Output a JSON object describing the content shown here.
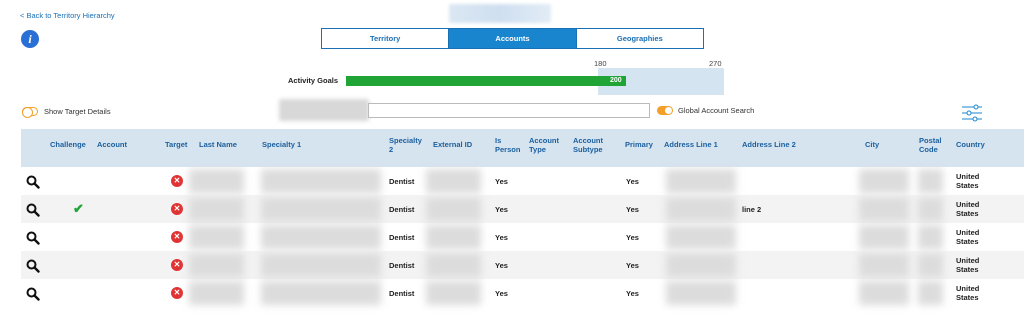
{
  "nav": {
    "back_link": "< Back to Territory Hierarchy"
  },
  "tabs": [
    {
      "label": "Territory",
      "active": false
    },
    {
      "label": "Accounts",
      "active": true
    },
    {
      "label": "Geographies",
      "active": false
    }
  ],
  "activity_goals": {
    "label": "Activity Goals",
    "current": 200,
    "current_label": "200",
    "range_min": 180,
    "range_min_label": "180",
    "range_max": 270,
    "range_max_label": "270",
    "bar_color": "#21a436",
    "range_color": "#d4e4f1"
  },
  "controls": {
    "show_target_details": "Show Target Details",
    "global_account_search": "Global Account Search",
    "search_placeholder": ""
  },
  "table": {
    "headers": {
      "challenge": "Challenge",
      "account": "Account",
      "target": "Target",
      "last_name": "Last Name",
      "specialty_1": "Specialty 1",
      "specialty_2": "Specialty 2",
      "external_id": "External ID",
      "is_person": "Is Person",
      "account_type": "Account Type",
      "account_subtype": "Account Subtype",
      "primary": "Primary",
      "address_line_1": "Address Line 1",
      "address_line_2": "Address Line 2",
      "city": "City",
      "postal_code": "Postal Code",
      "country": "Country"
    },
    "rows": [
      {
        "challenge": false,
        "target": false,
        "specialty_2": "Dentist",
        "is_person": "Yes",
        "primary": "Yes",
        "address_line_2": "",
        "country": "United States"
      },
      {
        "challenge": true,
        "target": false,
        "specialty_2": "Dentist",
        "is_person": "Yes",
        "primary": "Yes",
        "address_line_2": "line 2",
        "country": "United States"
      },
      {
        "challenge": false,
        "target": false,
        "specialty_2": "Dentist",
        "is_person": "Yes",
        "primary": "Yes",
        "address_line_2": "",
        "country": "United States"
      },
      {
        "challenge": false,
        "target": false,
        "specialty_2": "Dentist",
        "is_person": "Yes",
        "primary": "Yes",
        "address_line_2": "",
        "country": "United States"
      },
      {
        "challenge": false,
        "target": false,
        "specialty_2": "Dentist",
        "is_person": "Yes",
        "primary": "Yes",
        "address_line_2": "",
        "country": "United States"
      }
    ]
  },
  "icons": {
    "info": "info-icon",
    "view": "magnifier-icon",
    "challenge_check": "checkmark-icon",
    "target_status": "x-circle-icon",
    "filter": "sliders-icon"
  },
  "colors": {
    "accent": "#1a6fb5",
    "tab_active": "#1a85cf",
    "toggle": "#f2a02a",
    "danger": "#e03434",
    "success": "#21a436",
    "header_bg": "#d6e4f0"
  }
}
